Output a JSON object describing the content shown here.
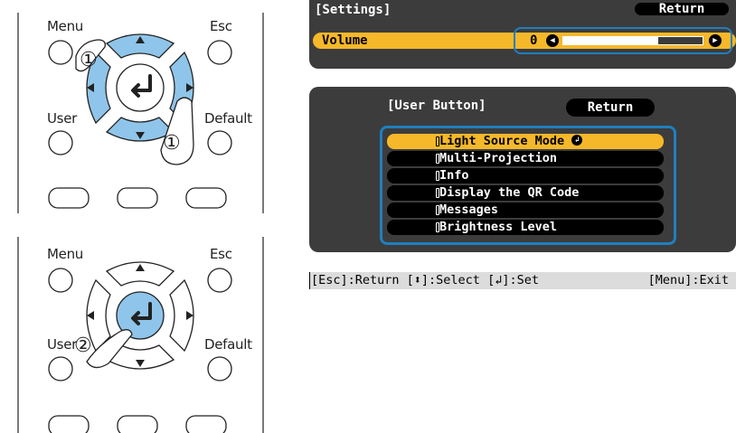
{
  "remote_step1": {
    "labels": {
      "menu": "Menu",
      "esc": "Esc",
      "user": "User",
      "default": "Default"
    },
    "step_badge": "①",
    "arrows": {
      "up": "▲",
      "down": "▼",
      "left": "◀",
      "right": "▶"
    },
    "highlighted": [
      "up",
      "down",
      "left",
      "right"
    ]
  },
  "remote_step2": {
    "labels": {
      "menu": "Menu",
      "esc": "Esc",
      "user": "User",
      "default": "Default"
    },
    "step_badge": "②",
    "arrows": {
      "up": "▲",
      "down": "▼",
      "left": "◀",
      "right": "▶"
    },
    "highlighted": [
      "enter"
    ]
  },
  "settings_menu": {
    "title": "[Settings]",
    "return_label": "Return",
    "volume": {
      "label": "Volume",
      "value": "0",
      "level_fraction": 0.68,
      "decrease_icon": "◀",
      "increase_icon": "▶"
    }
  },
  "user_button_menu": {
    "title": "[User Button]",
    "return_label": "Return",
    "items": [
      {
        "label": "Light Source Mode",
        "selected": true
      },
      {
        "label": "Multi-Projection",
        "selected": false
      },
      {
        "label": "Info",
        "selected": false
      },
      {
        "label": "Display the QR Code",
        "selected": false
      },
      {
        "label": "Messages",
        "selected": false
      },
      {
        "label": "Brightness Level",
        "selected": false
      }
    ],
    "enter_icon": "↲"
  },
  "help_bar": {
    "left": "[Esc]:Return [⬍]:Select [↲]:Set",
    "right": "[Menu]:Exit"
  },
  "colors": {
    "highlight_blue": "#1f7fc0",
    "arrow_blue": "#8fc5ea",
    "selected_yellow": "#f5b82a",
    "osd_background": "#3c3c3c",
    "help_bar_background": "#dcdcdc"
  }
}
